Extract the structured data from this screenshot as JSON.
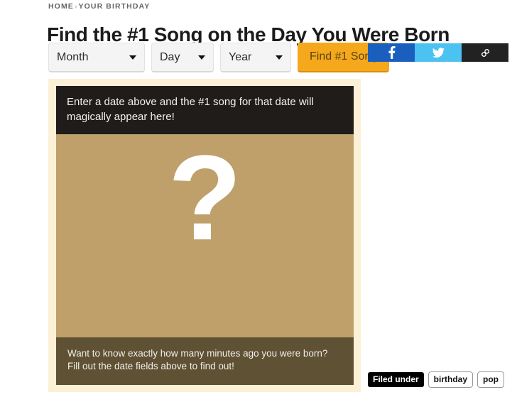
{
  "breadcrumb": {
    "home": "HOME",
    "separator": "›",
    "current": "YOUR BIRTHDAY"
  },
  "header": {
    "title": "Find the #1 Song on the Day You Were Born"
  },
  "form": {
    "month": {
      "label": "Month",
      "icon": "chevron-down-icon"
    },
    "day": {
      "label": "Day",
      "icon": "chevron-down-icon"
    },
    "year": {
      "label": "Year",
      "icon": "chevron-down-icon"
    },
    "submit_label": "Find #1 Song",
    "accent_color": "#f5a81c"
  },
  "share": {
    "facebook": {
      "icon": "facebook-icon",
      "color": "#1b5fbe"
    },
    "twitter": {
      "icon": "twitter-icon",
      "color": "#4cc2f1"
    },
    "link": {
      "icon": "link-icon",
      "color": "#222222"
    }
  },
  "result_card": {
    "header_text": "Enter a date above and the #1 song for that date will magically appear here!",
    "placeholder_glyph": "?",
    "footer_text": "Want to know exactly how many minutes ago you were born? Fill out the date fields above to find out!",
    "frame_color": "#fcf0d7",
    "body_color": "#bfa06a",
    "header_color": "#201c19",
    "footer_color": "#5e5134"
  },
  "filed_under": {
    "label": "Filed under",
    "tags": [
      "birthday",
      "pop"
    ]
  }
}
